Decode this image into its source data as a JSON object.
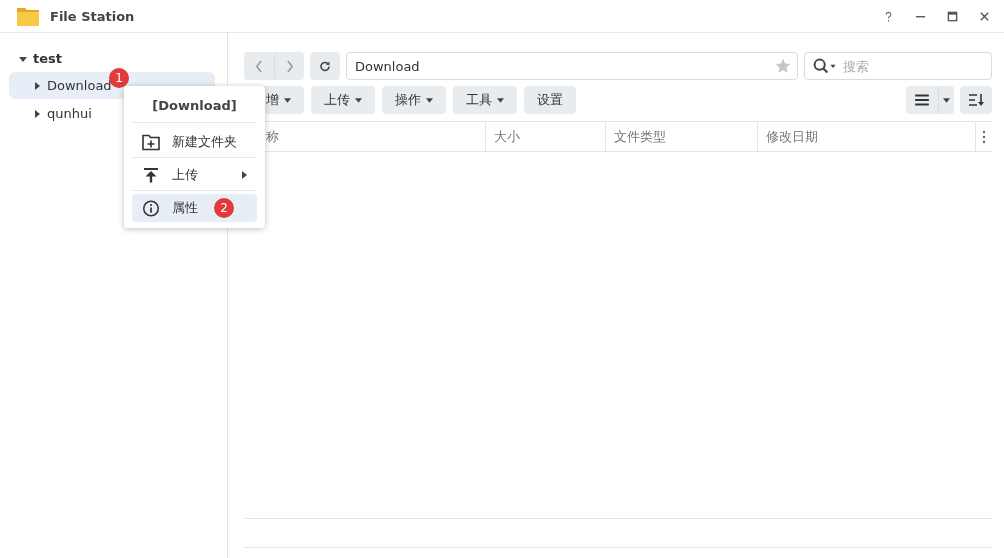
{
  "window": {
    "title": "File Station"
  },
  "tree": [
    {
      "label": "test",
      "expanded": true,
      "children": [
        {
          "label": "Download",
          "expanded": false,
          "selected": true,
          "badge": "1"
        },
        {
          "label": "qunhui",
          "expanded": false,
          "selected": false
        }
      ]
    }
  ],
  "path_field": {
    "value": "Download"
  },
  "search": {
    "placeholder": "搜索"
  },
  "toolbar": [
    {
      "label": "增",
      "dropdown": true
    },
    {
      "label": "上传",
      "dropdown": true
    },
    {
      "label": "操作",
      "dropdown": true
    },
    {
      "label": "工具",
      "dropdown": true
    },
    {
      "label": "设置",
      "dropdown": false
    }
  ],
  "table": {
    "columns": [
      "称",
      "大小",
      "文件类型",
      "修改日期"
    ]
  },
  "context_menu": {
    "title": "[Download]",
    "items": [
      {
        "kind": "new-folder",
        "label": "新建文件夹",
        "submenu": false,
        "selected": false
      },
      {
        "kind": "upload",
        "label": "上传",
        "submenu": true,
        "selected": false
      },
      {
        "kind": "info",
        "label": "属性",
        "submenu": false,
        "selected": true,
        "badge": "2"
      }
    ]
  }
}
